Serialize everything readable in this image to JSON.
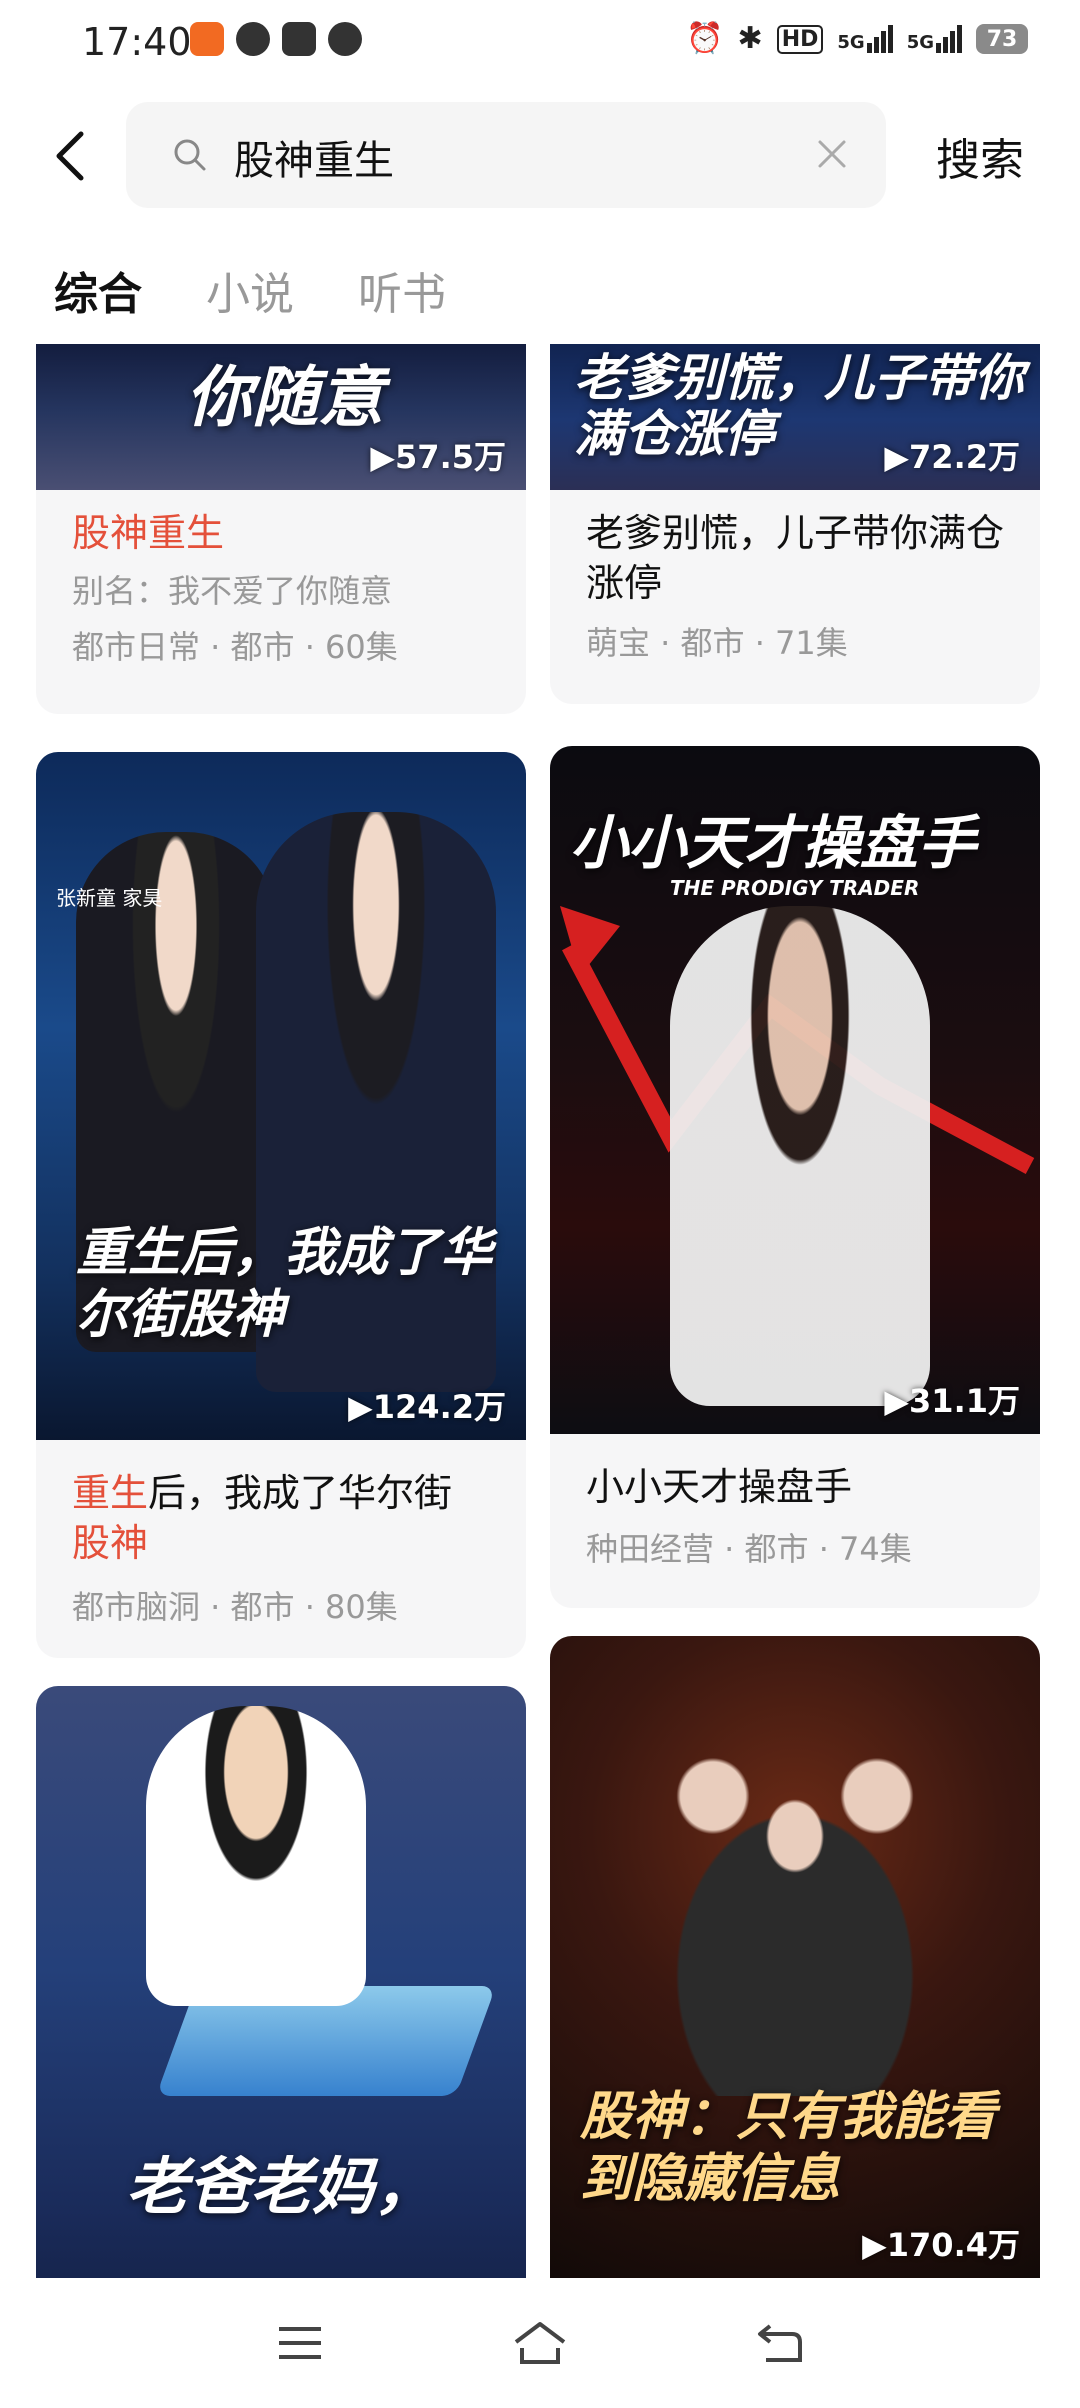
{
  "status_bar": {
    "time": "17:40",
    "icons": [
      "app-notification-icon",
      "wechat-icon",
      "calendar-icon",
      "search-app-icon"
    ],
    "right_icons": [
      "alarm-icon",
      "bluetooth-icon",
      "hd-icon",
      "5g-signal-icon",
      "5g-signal-icon"
    ],
    "hd_label": "HD",
    "net1": "5G",
    "net2": "5G",
    "battery": "73"
  },
  "search": {
    "query": "股神重生",
    "button_label": "搜索"
  },
  "tabs": [
    {
      "label": "综合",
      "active": true
    },
    {
      "label": "小说",
      "active": false
    },
    {
      "label": "听书",
      "active": false
    }
  ],
  "cards": [
    {
      "cover_text": "你随意",
      "views": "▶57.5万",
      "title_hl": "股神重生",
      "title_rest": "",
      "alias": "别名：我不爱了你随意",
      "tags": "都市日常 · 都市 · 60集"
    },
    {
      "cover_text": "老爹别慌，儿子带你满仓涨停",
      "views": "▶72.2万",
      "title": "老爹别慌，儿子带你满仓涨停",
      "tags": "萌宝 · 都市 · 71集"
    },
    {
      "cover_text": "重生后，我成了华尔街股神",
      "cover_sub": "张新童 家昊",
      "views": "▶124.2万",
      "title_hl1": "重生",
      "title_mid": "后，我成了华尔街",
      "title_hl2": "股神",
      "tags": "都市脑洞 · 都市 · 80集"
    },
    {
      "cover_text": "小小天才操盘手",
      "cover_sub": "THE PRODIGY TRADER",
      "views": "▶31.1万",
      "title": "小小天才操盘手",
      "tags": "种田经营 · 都市 · 74集"
    },
    {
      "cover_text": "老爸老妈，"
    },
    {
      "cover_text": "股神：只有我能看到隐藏信息",
      "views": "▶170.4万"
    }
  ],
  "colors": {
    "highlight": "#e4503a",
    "meta_gray": "#999999",
    "card_bg": "#f6f6f7"
  }
}
